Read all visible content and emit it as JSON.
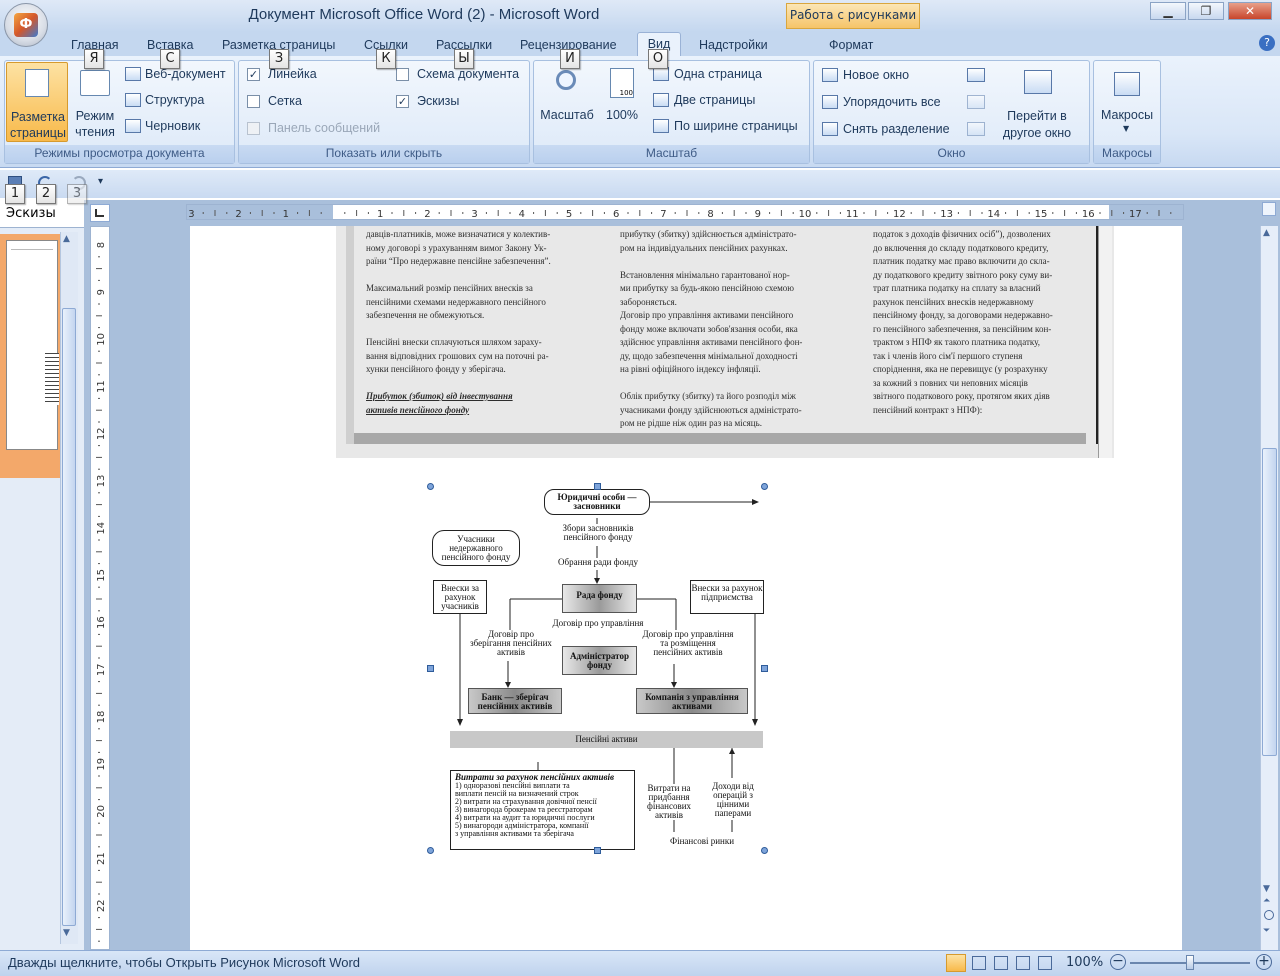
{
  "window": {
    "title": "Документ Microsoft Office Word (2) - Microsoft Word",
    "context_tab": "Работа с рисунками"
  },
  "tabs": [
    "Главная",
    "Вставка",
    "Разметка страницы",
    "Ссылки",
    "Рассылки",
    "Рецензирование",
    "Вид",
    "Надстройки",
    "Формат"
  ],
  "keytips": {
    "home": "Я",
    "insert": "С",
    "layout": "З",
    "refs": "К",
    "mail": "Ы",
    "review": "И",
    "view": "О",
    "q1": "1",
    "q2": "2",
    "q3": "3"
  },
  "ribbon": {
    "views": {
      "print_layout": "Разметка страницы",
      "reading": "Режим чтения",
      "web": "Веб-документ",
      "outline": "Структура",
      "draft": "Черновик",
      "label": "Режимы просмотра документа"
    },
    "show": {
      "ruler": "Линейка",
      "grid": "Сетка",
      "msgbar": "Панель сообщений",
      "docmap": "Схема документа",
      "thumbs": "Эскизы",
      "label": "Показать или скрыть",
      "ruler_checked": true,
      "grid_checked": false,
      "docmap_checked": false,
      "thumbs_checked": true
    },
    "zoom": {
      "zoom": "Масштаб",
      "pct": "100%",
      "pct_icon": "100",
      "one": "Одна страница",
      "two": "Две страницы",
      "width": "По ширине страницы",
      "label": "Масштаб"
    },
    "window": {
      "new": "Новое окно",
      "arrange": "Упорядочить все",
      "split": "Снять разделение",
      "switch": "Перейти в другое окно",
      "label": "Окно"
    },
    "macros": {
      "macros": "Макросы",
      "label": "Макросы"
    }
  },
  "thumb_pane": {
    "label": "Эскизы"
  },
  "document": {
    "col1": [
      "давців-платників, може визначатися у колектив-",
      "ному договорі з урахуванням вимог Закону Ук-",
      "раїни “Про недержавне пенсійне забезпечення”.",
      "",
      "Максимальний розмір пенсійних внесків за",
      "пенсійними схемами недержавного пенсійного",
      "забезпечення не обмежуються.",
      "",
      "Пенсійні внески сплачуються шляхом зараху-",
      "вання відповідних грошових сум на поточні ра-",
      "хунки пенсійного фонду у зберігача.",
      "",
      "Прибуток (збиток) від інвестування",
      "активів пенсійного фонду"
    ],
    "col2": [
      "прибутку (збитку) здійснюється адміністрато-",
      "ром на індивідуальних пенсійних рахунках.",
      "",
      "Встановлення мінімально гарантованої нор-",
      "ми прибутку за будь-якою пенсійною схемою",
      "забороняється.",
      "Договір про управління активами пенсійного",
      "фонду може включати зобов'язання особи, яка",
      "здійснює управління активами пенсійного фон-",
      "ду, щодо забезпечення мінімальної доходності",
      "на рівні офіційного індексу інфляції.",
      "",
      "Облік прибутку (збитку) та його розподіл між",
      "учасниками фонду здійснюються адміністрато-",
      "ром не рідше ніж один раз на місяць."
    ],
    "col3": [
      "податок з доходів фізичних осіб”), дозволених",
      "до включення до складу податкового кредиту,",
      "платник податку має право включити до скла-",
      "ду податкового кредиту звітного року суму ви-",
      "трат платника податку на сплату за власний",
      "рахунок пенсійних внесків недержавному",
      "пенсійному фонду, за договорами недержавно-",
      "го пенсійного забезпечення, за пенсійним кон-",
      "трактом з НПФ як такого платника податку,",
      "так і членів його сім'ї першого ступеня",
      "споріднення, яка не перевищує (у розрахунку",
      "за кожний з повних чи неповних місяців",
      "звітного податкового року, протягом яких діяв",
      "пенсійний контракт з НПФ):"
    ]
  },
  "diagram": {
    "founders": "Юридичні особи — засновники",
    "founders_meeting": "Збори засновників пенсійного фонду",
    "elect_council": "Обрання ради фонду",
    "participants": "Учасники недержавного пенсійного фонду",
    "contrib_participants": "Внески за рахунок учасників",
    "council": "Рада фонду",
    "contrib_employer": "Внески за рахунок підприємства",
    "mgmt_contract": "Договір про управління",
    "custody_contract": "Договір про зберігання пенсійних активів",
    "am_contract": "Договір про управління та розміщення пенсійних активів",
    "administrator": "Адміністратор фонду",
    "bank": "Банк — зберігач пенсійних активів",
    "am_company": "Компанія з управління активами",
    "assets": "Пенсійні активи",
    "expenses_title": "Витрати за рахунок пенсійних активів",
    "expenses": [
      "1) одноразові пенсійні виплати та",
      "виплати пенсій на визначений строк",
      "2) витрати на страхування довічної пенсії",
      "3) винагорода брокерам та реєстраторам",
      "4) витрати на аудит та юридичні послуги",
      "5) винагороди адміністратора, компанії",
      "з управління активами та зберігача"
    ],
    "purchase": "Витрати на придбання фінансових активів",
    "income": "Доходи від операцій з цінними паперами",
    "markets": "Фінансові ринки"
  },
  "status": {
    "text": "Дважды щелкните, чтобы Открыть Рисунок Microsoft Word",
    "zoom": "100%"
  }
}
